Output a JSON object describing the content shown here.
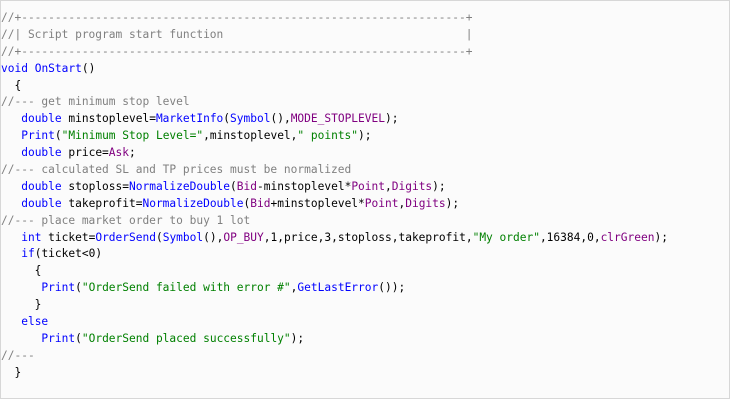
{
  "colors": {
    "background": "#fbfbfb",
    "border": "#d7d7d7",
    "comment": "#808080",
    "keyword": "#0000ff",
    "function": "#0000ff",
    "constant": "#800080",
    "string": "#008000",
    "text": "#000000"
  },
  "code": [
    [
      {
        "t": "comment",
        "s": "//+------------------------------------------------------------------+"
      }
    ],
    [
      {
        "t": "comment",
        "s": "//| Script program start function                                    |"
      }
    ],
    [
      {
        "t": "comment",
        "s": "//+------------------------------------------------------------------+"
      }
    ],
    [
      {
        "t": "keyword",
        "s": "void"
      },
      {
        "t": "text",
        "s": " "
      },
      {
        "t": "func",
        "s": "OnStart"
      },
      {
        "t": "text",
        "s": "()"
      }
    ],
    [
      {
        "t": "text",
        "s": "  {"
      }
    ],
    [
      {
        "t": "comment",
        "s": "//--- get minimum stop level"
      }
    ],
    [
      {
        "t": "text",
        "s": "   "
      },
      {
        "t": "keyword",
        "s": "double"
      },
      {
        "t": "text",
        "s": " minstoplevel="
      },
      {
        "t": "func",
        "s": "MarketInfo"
      },
      {
        "t": "text",
        "s": "("
      },
      {
        "t": "func",
        "s": "Symbol"
      },
      {
        "t": "text",
        "s": "(),"
      },
      {
        "t": "const",
        "s": "MODE_STOPLEVEL"
      },
      {
        "t": "text",
        "s": ");"
      }
    ],
    [
      {
        "t": "text",
        "s": "   "
      },
      {
        "t": "func",
        "s": "Print"
      },
      {
        "t": "text",
        "s": "("
      },
      {
        "t": "string",
        "s": "\"Minimum Stop Level=\""
      },
      {
        "t": "text",
        "s": ",minstoplevel,"
      },
      {
        "t": "string",
        "s": "\" points\""
      },
      {
        "t": "text",
        "s": ");"
      }
    ],
    [
      {
        "t": "text",
        "s": "   "
      },
      {
        "t": "keyword",
        "s": "double"
      },
      {
        "t": "text",
        "s": " price="
      },
      {
        "t": "const",
        "s": "Ask"
      },
      {
        "t": "text",
        "s": ";"
      }
    ],
    [
      {
        "t": "comment",
        "s": "//--- calculated SL and TP prices must be normalized"
      }
    ],
    [
      {
        "t": "text",
        "s": "   "
      },
      {
        "t": "keyword",
        "s": "double"
      },
      {
        "t": "text",
        "s": " stoploss="
      },
      {
        "t": "func",
        "s": "NormalizeDouble"
      },
      {
        "t": "text",
        "s": "("
      },
      {
        "t": "const",
        "s": "Bid"
      },
      {
        "t": "text",
        "s": "-minstoplevel*"
      },
      {
        "t": "const",
        "s": "Point"
      },
      {
        "t": "text",
        "s": ","
      },
      {
        "t": "const",
        "s": "Digits"
      },
      {
        "t": "text",
        "s": ");"
      }
    ],
    [
      {
        "t": "text",
        "s": "   "
      },
      {
        "t": "keyword",
        "s": "double"
      },
      {
        "t": "text",
        "s": " takeprofit="
      },
      {
        "t": "func",
        "s": "NormalizeDouble"
      },
      {
        "t": "text",
        "s": "("
      },
      {
        "t": "const",
        "s": "Bid"
      },
      {
        "t": "text",
        "s": "+minstoplevel*"
      },
      {
        "t": "const",
        "s": "Point"
      },
      {
        "t": "text",
        "s": ","
      },
      {
        "t": "const",
        "s": "Digits"
      },
      {
        "t": "text",
        "s": ");"
      }
    ],
    [
      {
        "t": "comment",
        "s": "//--- place market order to buy 1 lot"
      }
    ],
    [
      {
        "t": "text",
        "s": "   "
      },
      {
        "t": "keyword",
        "s": "int"
      },
      {
        "t": "text",
        "s": " ticket="
      },
      {
        "t": "func",
        "s": "OrderSend"
      },
      {
        "t": "text",
        "s": "("
      },
      {
        "t": "func",
        "s": "Symbol"
      },
      {
        "t": "text",
        "s": "(),"
      },
      {
        "t": "const",
        "s": "OP_BUY"
      },
      {
        "t": "text",
        "s": ",1,price,3,stoploss,takeprofit,"
      },
      {
        "t": "string",
        "s": "\"My order\""
      },
      {
        "t": "text",
        "s": ",16384,0,"
      },
      {
        "t": "const",
        "s": "clrGreen"
      },
      {
        "t": "text",
        "s": ");"
      }
    ],
    [
      {
        "t": "text",
        "s": "   "
      },
      {
        "t": "keyword",
        "s": "if"
      },
      {
        "t": "text",
        "s": "(ticket<0)"
      }
    ],
    [
      {
        "t": "text",
        "s": "     {"
      }
    ],
    [
      {
        "t": "text",
        "s": "      "
      },
      {
        "t": "func",
        "s": "Print"
      },
      {
        "t": "text",
        "s": "("
      },
      {
        "t": "string",
        "s": "\"OrderSend failed with error #\""
      },
      {
        "t": "text",
        "s": ","
      },
      {
        "t": "func",
        "s": "GetLastError"
      },
      {
        "t": "text",
        "s": "());"
      }
    ],
    [
      {
        "t": "text",
        "s": "     }"
      }
    ],
    [
      {
        "t": "text",
        "s": "   "
      },
      {
        "t": "keyword",
        "s": "else"
      }
    ],
    [
      {
        "t": "text",
        "s": "      "
      },
      {
        "t": "func",
        "s": "Print"
      },
      {
        "t": "text",
        "s": "("
      },
      {
        "t": "string",
        "s": "\"OrderSend placed successfully\""
      },
      {
        "t": "text",
        "s": ");"
      }
    ],
    [
      {
        "t": "comment",
        "s": "//---"
      }
    ],
    [
      {
        "t": "text",
        "s": "  }"
      }
    ]
  ]
}
